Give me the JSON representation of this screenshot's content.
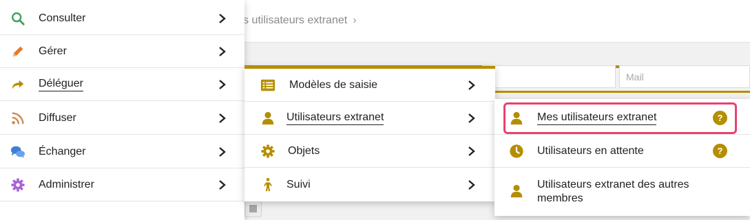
{
  "background": {
    "breadcrumb": "s utilisateurs extranet",
    "breadcrumb_chevron": "›",
    "mail_placeholder": "Mail",
    "accent_color": "#b58e00"
  },
  "menu_level_1": {
    "items": [
      {
        "label": "Consulter",
        "icon": "search-icon",
        "icon_color": "#3aa05a"
      },
      {
        "label": "Gérer",
        "icon": "pencil-icon",
        "icon_color": "#e8782a"
      },
      {
        "label": "Déléguer",
        "icon": "share-arrow-icon",
        "icon_color": "#b58e00",
        "active": true
      },
      {
        "label": "Diffuser",
        "icon": "rss-icon",
        "icon_color": "#c98a56"
      },
      {
        "label": "Échanger",
        "icon": "chat-bubbles-icon",
        "icon_color": "#3d7fd6"
      },
      {
        "label": "Administrer",
        "icon": "gear-icon",
        "icon_color": "#a865d4"
      }
    ]
  },
  "menu_level_2": {
    "items": [
      {
        "label": "Modèles de saisie",
        "icon": "list-icon"
      },
      {
        "label": "Utilisateurs extranet",
        "icon": "user-icon",
        "active": true
      },
      {
        "label": "Objets",
        "icon": "gear-icon"
      },
      {
        "label": "Suivi",
        "icon": "person-walking-icon"
      }
    ]
  },
  "menu_level_3": {
    "items": [
      {
        "label": "Mes utilisateurs extranet",
        "icon": "user-icon",
        "help": "?",
        "highlighted": true
      },
      {
        "label": "Utilisateurs en attente",
        "icon": "clock-icon",
        "help": "?"
      },
      {
        "label_line1": "Utilisateurs extranet des autres",
        "label_line2": "membres",
        "icon": "user-icon"
      }
    ]
  },
  "colors": {
    "gold": "#b58e00",
    "highlight": "#e8426e"
  }
}
